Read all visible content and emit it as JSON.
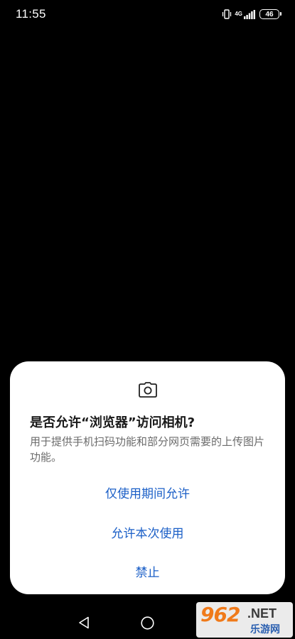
{
  "status_bar": {
    "time": "11:55",
    "network_type": "4G",
    "battery_level": "46"
  },
  "dialog": {
    "icon": "camera-icon",
    "title": "是否允许“浏览器”访问相机?",
    "message": "用于提供手机扫码功能和部分网页需要的上传图片功能。",
    "buttons": [
      {
        "label": "仅使用期间允许"
      },
      {
        "label": "允许本次使用"
      },
      {
        "label": "禁止"
      }
    ]
  },
  "nav_bar": {
    "back": "back-icon",
    "home": "home-icon"
  },
  "watermark": {
    "logo": "962",
    "suffix": ".NET",
    "text": "乐游网"
  },
  "colors": {
    "background": "#000000",
    "dialog_bg": "#ffffff",
    "button_text": "#1b5fc7",
    "title_text": "#1a1a1a",
    "message_text": "#6b6b6b"
  }
}
